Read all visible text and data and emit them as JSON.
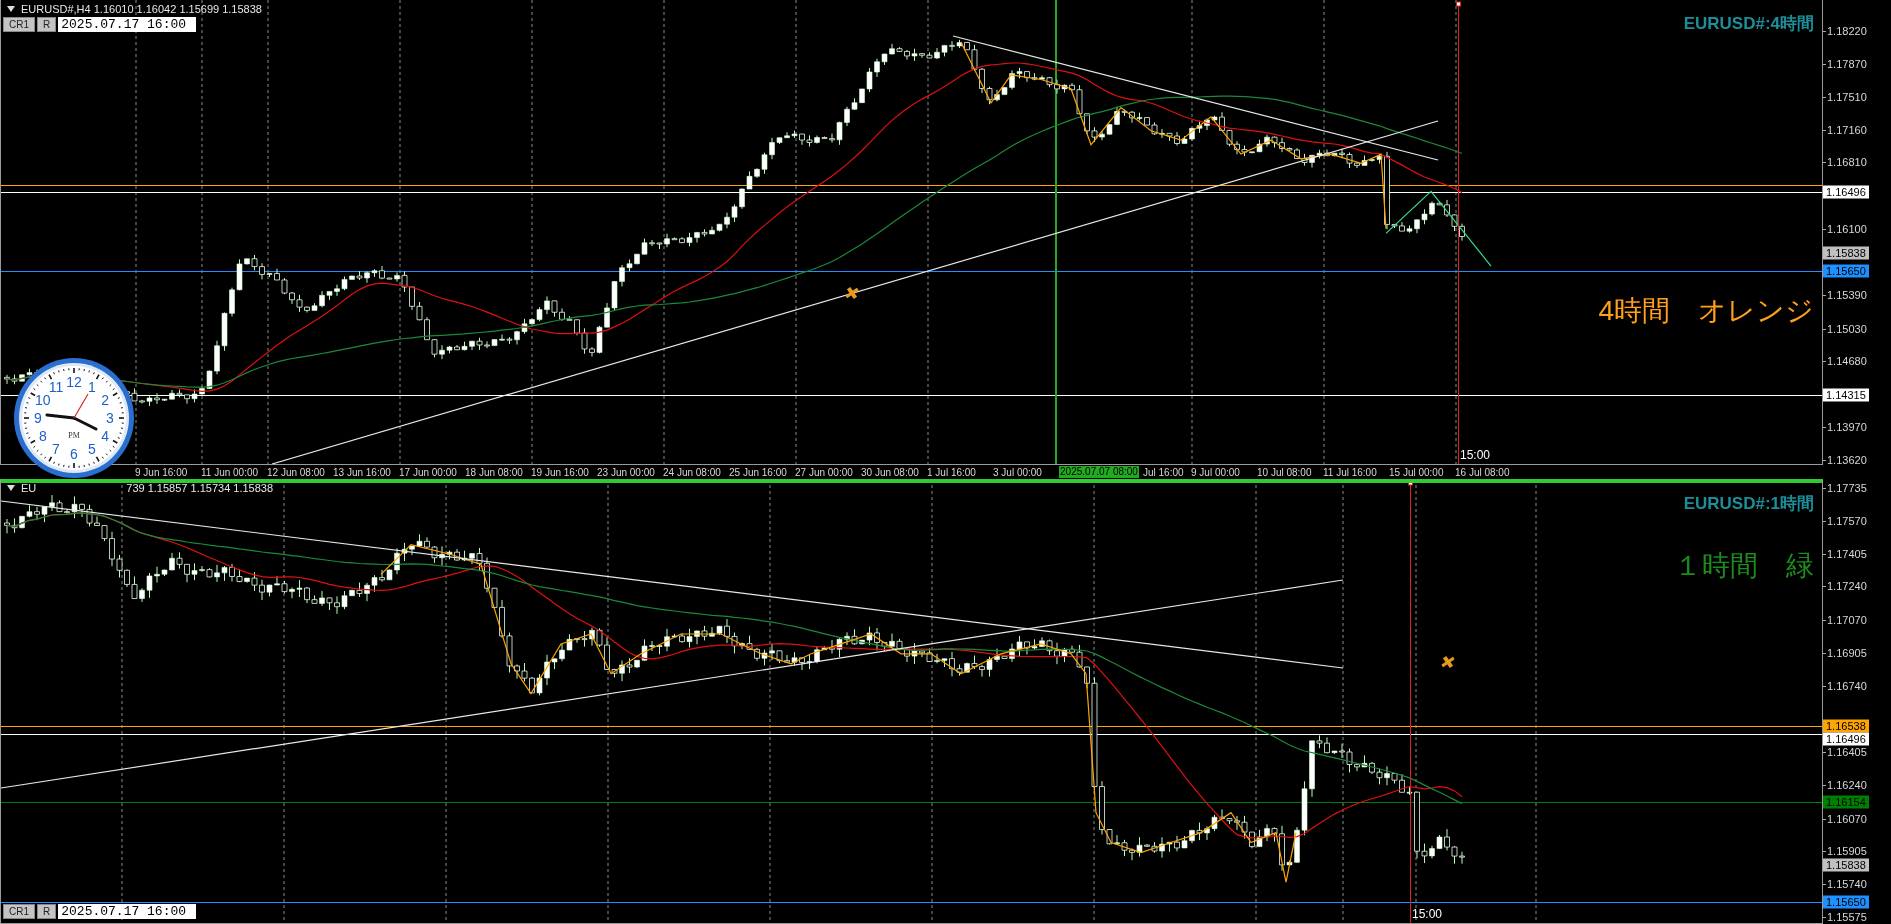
{
  "panels": [
    {
      "kind": "upper",
      "active": false,
      "header": {
        "symbol_parts": [
          "EURUSD#,H4  1.16010 1.16042 1.15699 1.15838"
        ]
      },
      "toolbar": {
        "buttons": [
          "CR1",
          "R"
        ],
        "date": "2025.07.17 16:00"
      },
      "title": "EURUSD#:4時間",
      "caption": {
        "text": "4時間　オレンジ",
        "color": "#ff9f1a"
      },
      "marker_label": "15:00",
      "axis": [
        {
          "text": "1.18220",
          "kind": "tick"
        },
        {
          "text": "1.17870",
          "kind": "tick"
        },
        {
          "text": "1.17510",
          "kind": "tick"
        },
        {
          "text": "1.17160",
          "kind": "tick"
        },
        {
          "text": "1.16810",
          "kind": "tick"
        },
        {
          "text": "1.16496",
          "kind": "level",
          "color": "#ffffff"
        },
        {
          "text": "1.16100",
          "kind": "tick"
        },
        {
          "text": "1.15838",
          "kind": "bid"
        },
        {
          "text": "1.15650",
          "kind": "level",
          "color": "#1e90ff"
        },
        {
          "text": "1.15390",
          "kind": "tick"
        },
        {
          "text": "1.15030",
          "kind": "tick"
        },
        {
          "text": "1.14680",
          "kind": "tick"
        },
        {
          "text": "1.14315",
          "kind": "level",
          "color": "#ffffff"
        },
        {
          "text": "1.13970",
          "kind": "tick"
        },
        {
          "text": "1.13620",
          "kind": "tick"
        }
      ],
      "time_axis": [
        {
          "text": "9 Jun 16:00",
          "kind": "tick"
        },
        {
          "text": "11 Jun 00:00",
          "kind": "tick"
        },
        {
          "text": "12 Jun 08:00",
          "kind": "tick"
        },
        {
          "text": "13 Jun 16:00",
          "kind": "tick"
        },
        {
          "text": "17 Jun 00:00",
          "kind": "tick"
        },
        {
          "text": "18 Jun 08:00",
          "kind": "tick"
        },
        {
          "text": "19 Jun 16:00",
          "kind": "tick"
        },
        {
          "text": "23 Jun 00:00",
          "kind": "tick"
        },
        {
          "text": "24 Jun 08:00",
          "kind": "tick"
        },
        {
          "text": "25 Jun 16:00",
          "kind": "tick"
        },
        {
          "text": "27 Jun 00:00",
          "kind": "tick"
        },
        {
          "text": "30 Jun 08:00",
          "kind": "tick"
        },
        {
          "text": "1 Jul 16:00",
          "kind": "tick"
        },
        {
          "text": "3 Jul 00:00",
          "kind": "tick"
        },
        {
          "text": "2025.07.07 08:00",
          "kind": "cursor"
        },
        {
          "text": "Jul 16:00",
          "kind": "partial"
        },
        {
          "text": "9 Jul 00:00",
          "kind": "tick"
        },
        {
          "text": "10 Jul 08:00",
          "kind": "tick"
        },
        {
          "text": "11 Jul 16:00",
          "kind": "tick"
        },
        {
          "text": "15 Jul 00:00",
          "kind": "tick"
        },
        {
          "text": "16 Jul 08:00",
          "kind": "tick"
        }
      ]
    },
    {
      "kind": "lower",
      "active": true,
      "header": {
        "symbol_parts": [
          "EU",
          "739 1.15857 1.15734 1.15838"
        ]
      },
      "toolbar": {
        "buttons": [
          "CR1",
          "R"
        ],
        "date": "2025.07.17 16:00"
      },
      "title": "EURUSD#:1時間",
      "caption": {
        "text": "１時間　緑",
        "color": "#1c8c1c"
      },
      "marker_label": "15:00",
      "axis": [
        {
          "text": "1.17735",
          "kind": "tick"
        },
        {
          "text": "1.17570",
          "kind": "tick"
        },
        {
          "text": "1.17405",
          "kind": "tick"
        },
        {
          "text": "1.17240",
          "kind": "tick"
        },
        {
          "text": "1.17070",
          "kind": "tick"
        },
        {
          "text": "1.16905",
          "kind": "tick"
        },
        {
          "text": "1.16740",
          "kind": "tick"
        },
        {
          "text": "1.16538",
          "kind": "level",
          "color": "#ffa500"
        },
        {
          "text": "1.16496",
          "kind": "level",
          "color": "#ffffff"
        },
        {
          "text": "1.16405",
          "kind": "tick"
        },
        {
          "text": "1.16240",
          "kind": "tick"
        },
        {
          "text": "1.16154",
          "kind": "level",
          "color": "#008000"
        },
        {
          "text": "1.16070",
          "kind": "tick"
        },
        {
          "text": "1.15905",
          "kind": "tick"
        },
        {
          "text": "1.15838",
          "kind": "bid"
        },
        {
          "text": "1.15740",
          "kind": "tick"
        },
        {
          "text": "1.15650",
          "kind": "level",
          "color": "#1e90ff"
        },
        {
          "text": "1.15575",
          "kind": "tick"
        }
      ]
    }
  ],
  "clock": {
    "numerals": [
      "12",
      "11",
      "1",
      "10",
      "2",
      "9",
      "3",
      "8",
      "4",
      "7",
      "5",
      "6"
    ],
    "period": "PM"
  }
}
